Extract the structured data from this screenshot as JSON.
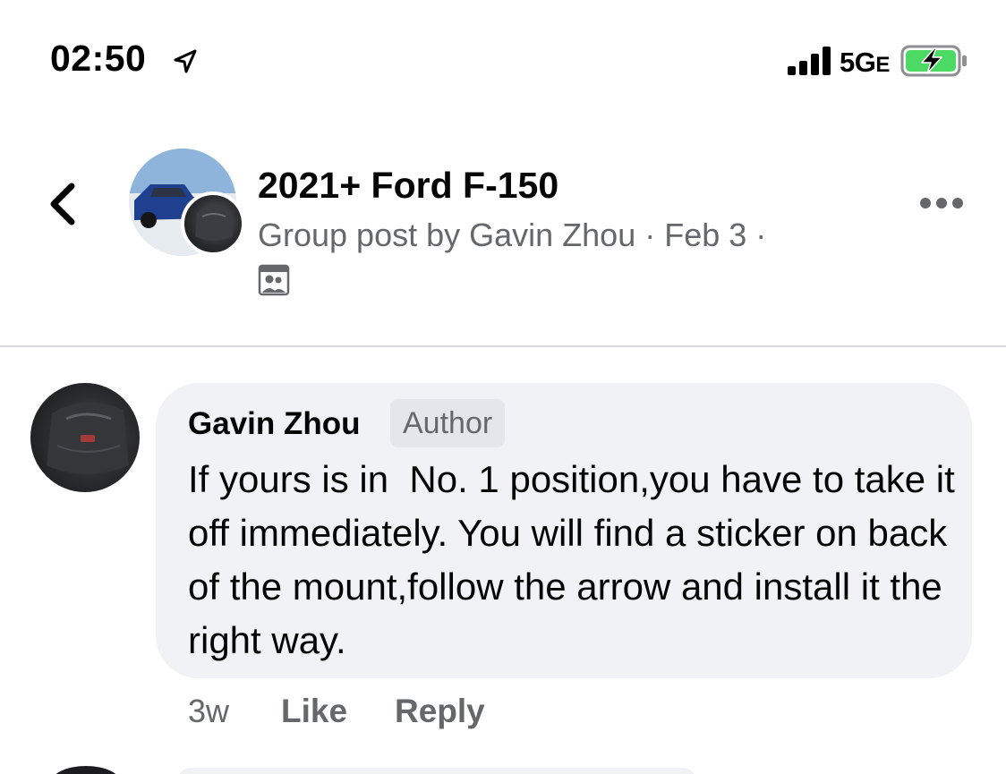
{
  "status_bar": {
    "time": "02:50",
    "network": "5G",
    "network_suffix": "E",
    "battery_color": "#4cd964"
  },
  "header": {
    "group_title": "2021+ Ford F-150",
    "post_meta": "Group post by Gavin Zhou · Feb 3 ·",
    "icons": [
      "back-chevron-icon",
      "group-members-icon",
      "more-options-icon"
    ]
  },
  "comment": {
    "author": "Gavin Zhou",
    "badge": "Author",
    "text": "If yours is in  No. 1 position,you have to take it off immediately. You will find a sticker on back of the mount,follow the arrow and install it the right way.",
    "time": "3w",
    "like_label": "Like",
    "reply_label": "Reply"
  },
  "colors": {
    "bubble": "#f0f2f5",
    "secondary_text": "#65676b",
    "primary_text": "#050505"
  }
}
